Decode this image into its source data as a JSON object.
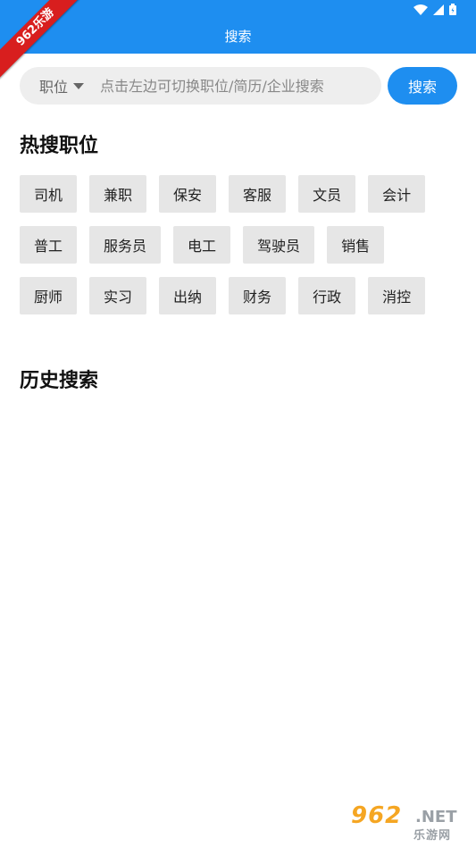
{
  "header": {
    "title": "搜索",
    "color": "#1e8ef0",
    "ribbon_text": "962乐游"
  },
  "status_bar": {
    "icons": [
      "wifi-icon",
      "signal-icon",
      "battery-icon"
    ]
  },
  "search": {
    "type_label": "职位",
    "placeholder": "点击左边可切换职位/简历/企业搜索",
    "value": "",
    "button_label": "搜索"
  },
  "hot": {
    "title": "热搜职位",
    "rows": [
      [
        "司机",
        "兼职",
        "保安",
        "客服",
        "文员",
        "会计"
      ],
      [
        "普工",
        "服务员",
        "电工",
        "驾驶员",
        "销售"
      ],
      [
        "厨师",
        "实习",
        "出纳",
        "财务",
        "行政",
        "消控"
      ]
    ]
  },
  "history": {
    "title": "历史搜索",
    "items": []
  },
  "watermark": {
    "brand": "962",
    "suffix": ".NET",
    "tagline": "乐游网"
  }
}
